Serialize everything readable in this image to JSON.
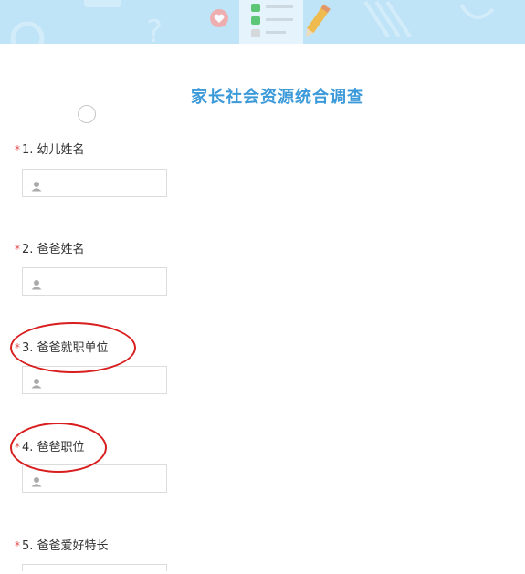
{
  "survey": {
    "title": "家长社会资源统合调查",
    "required_mark": "*",
    "questions": [
      {
        "number": "1.",
        "label": "幼儿姓名",
        "value": ""
      },
      {
        "number": "2.",
        "label": "爸爸姓名",
        "value": ""
      },
      {
        "number": "3.",
        "label": "爸爸就职单位",
        "value": ""
      },
      {
        "number": "4.",
        "label": "爸爸职位",
        "value": ""
      },
      {
        "number": "5.",
        "label": "爸爸爱好特长",
        "value": ""
      }
    ]
  },
  "banner": {
    "icons": [
      "heart-icon",
      "checklist-icon",
      "pencil-icon"
    ]
  },
  "colors": {
    "title": "#3d9ad9",
    "required": "#e24b4b",
    "banner": "#bfe3f7",
    "annotation": "#d81e1e"
  }
}
